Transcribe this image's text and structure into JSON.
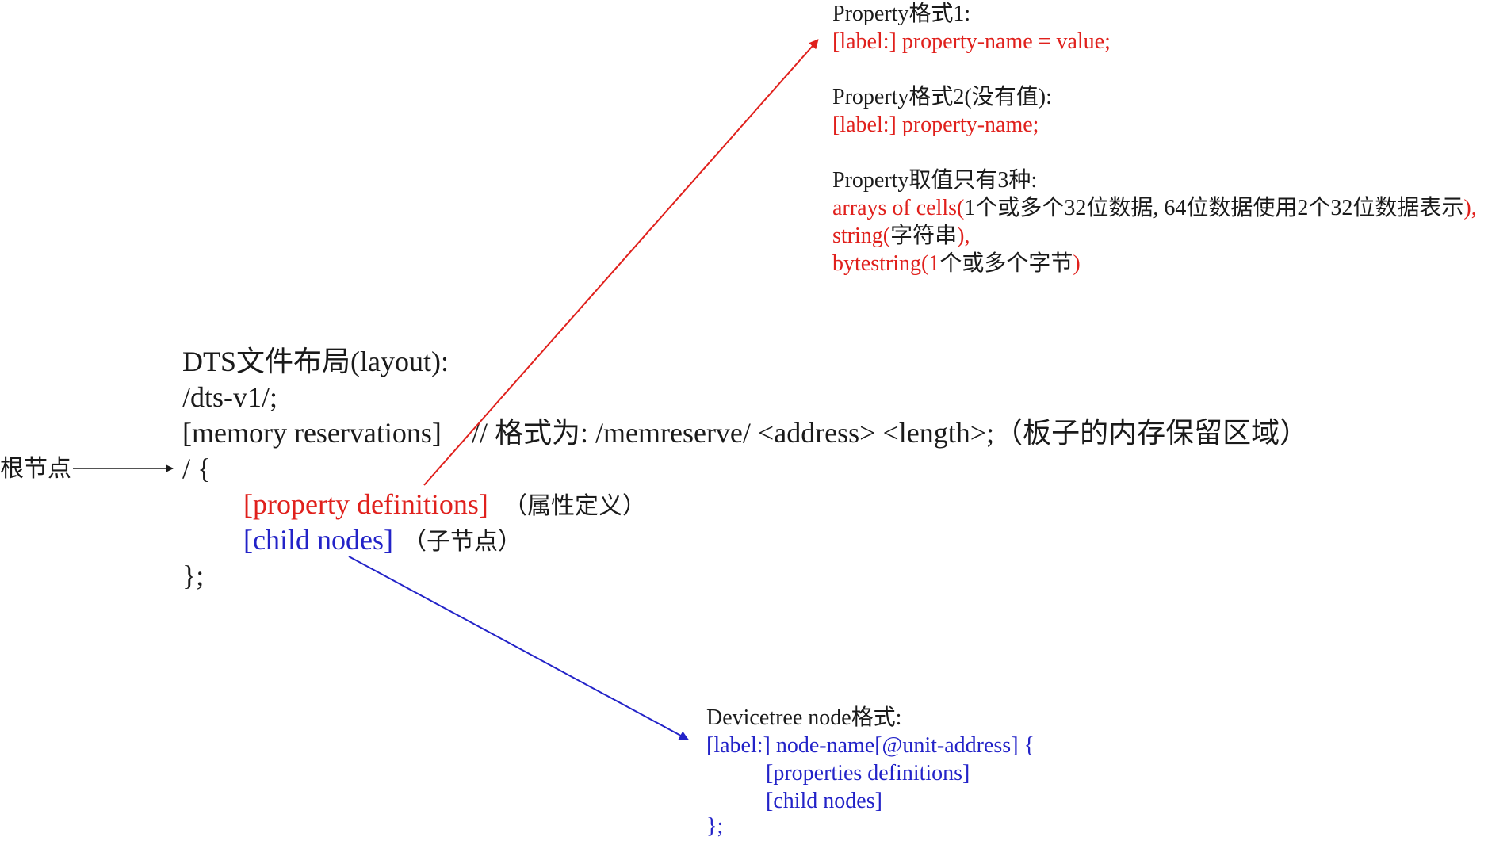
{
  "property_box": {
    "format1_heading": "Property格式1:",
    "format1_syntax": "[label:] property-name = value;",
    "format2_heading": "Property格式2(没有值):",
    "format2_syntax": "[label:] property-name;",
    "values_heading": "Property取值只有3种:",
    "value_cells_red": "arrays of cells(",
    "value_cells_black": "1个或多个32位数据, 64位数据使用2个32位数据表示",
    "value_cells_end": "),",
    "value_string_red": "string(",
    "value_string_black": "字符串",
    "value_string_end": "),",
    "value_bytestring_red": "bytestring(1",
    "value_bytestring_black": "个或多个字节",
    "value_bytestring_end": ")"
  },
  "layout": {
    "title": "DTS文件布局(layout):",
    "version_line": "/dts-v1/;",
    "memory_reservations": "[memory reservations]",
    "memreserve_comment": "// 格式为: /memreserve/ <address> <length>;（板子的内存保留区域）",
    "root_open": "/ {",
    "property_definitions": "[property definitions]",
    "property_definitions_note": "（属性定义）",
    "child_nodes": "[child nodes]",
    "child_nodes_note": "（子节点）",
    "root_close": "};",
    "root_label": "根节点"
  },
  "node_box": {
    "heading": "Devicetree node格式:",
    "line1": "[label:] node-name[@unit-address] {",
    "line2": "[properties definitions]",
    "line3": "[child nodes]",
    "line4": "};"
  },
  "colors": {
    "red": "#e0201c",
    "blue": "#2323c8",
    "black": "#1a1a1a"
  }
}
